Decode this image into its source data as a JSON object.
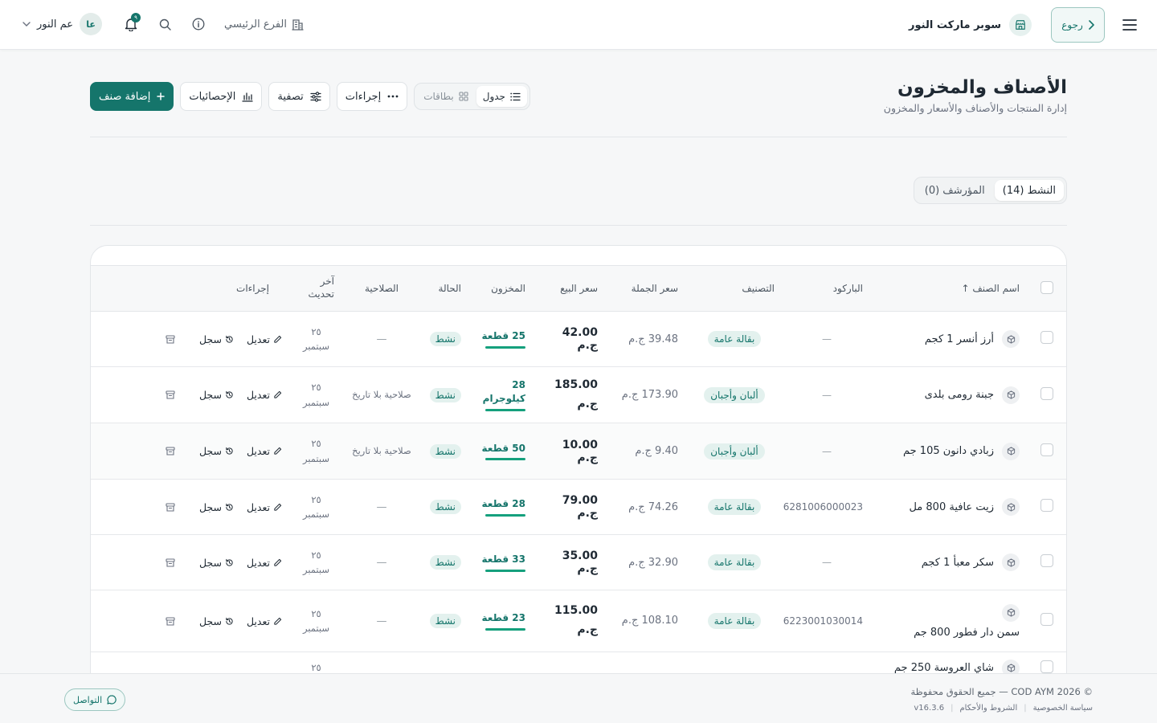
{
  "topbar": {
    "back_label": "رجوع",
    "store_name": "سوبر ماركت النور",
    "branch_label": "الفرع الرئيسي",
    "notifications_count": "٩",
    "user_initials": "عا",
    "user_name": "عم النور"
  },
  "header": {
    "title": "الأصناف والمخزون",
    "subtitle": "إدارة المنتجات والأصناف والأسعار والمخزون"
  },
  "toolbar": {
    "view_table": "جدول",
    "view_cards": "بطاقات",
    "actions_label": "إجراءات",
    "filter_label": "تصفية",
    "stats_label": "الإحصائيات",
    "add_label": "إضافة صنف"
  },
  "tabs": {
    "active_label": "النشط (14)",
    "archived_label": "المؤرشف (0)"
  },
  "table": {
    "columns": {
      "name": "اسم الصنف ↑",
      "barcode": "الباركود",
      "category": "التصنيف",
      "wholesale": "سعر الجملة",
      "sale": "سعر البيع",
      "stock": "المخزون",
      "status": "الحالة",
      "expiry": "الصلاحية",
      "updated": "آخر تحديث",
      "actions": "إجراءات"
    },
    "edit_label": "تعديل",
    "log_label": "سجل",
    "rows": [
      {
        "name": "أرز أنسر 1 كجم",
        "barcode": "—",
        "category": "بقالة عامة",
        "wholesale": "39.48 ج.م",
        "sale": "42.00 ج.م",
        "stock": "25 قطعة",
        "status": "نشط",
        "expiry": "—",
        "updated": "٢٥ سبتمبر"
      },
      {
        "name": "جبنة رومى بلدى",
        "barcode": "—",
        "category": "ألبان وأجبان",
        "wholesale": "173.90 ج.م",
        "sale": "185.00 ج.م",
        "stock": "28 كيلوجرام",
        "status": "نشط",
        "expiry": "صلاحية بلا تاريخ",
        "updated": "٢٥ سبتمبر"
      },
      {
        "name": "زبادي دانون 105 جم",
        "barcode": "—",
        "category": "ألبان وأجبان",
        "wholesale": "9.40 ج.م",
        "sale": "10.00 ج.م",
        "stock": "50 قطعة",
        "status": "نشط",
        "expiry": "صلاحية بلا تاريخ",
        "updated": "٢٥ سبتمبر"
      },
      {
        "name": "زيت عافية 800 مل",
        "barcode": "6281006000023",
        "category": "بقالة عامة",
        "wholesale": "74.26 ج.م",
        "sale": "79.00 ج.م",
        "stock": "28 قطعة",
        "status": "نشط",
        "expiry": "—",
        "updated": "٢٥ سبتمبر"
      },
      {
        "name": "سكر معبأ 1 كجم",
        "barcode": "—",
        "category": "بقالة عامة",
        "wholesale": "32.90 ج.م",
        "sale": "35.00 ج.م",
        "stock": "33 قطعة",
        "status": "نشط",
        "expiry": "—",
        "updated": "٢٥ سبتمبر"
      },
      {
        "name": "سمن دار فطور 800 جم",
        "barcode": "6223001030014",
        "category": "بقالة عامة",
        "wholesale": "108.10 ج.م",
        "sale": "115.00 ج.م",
        "stock": "23 قطعة",
        "status": "نشط",
        "expiry": "—",
        "updated": "٢٥ سبتمبر"
      },
      {
        "name": "شاي العروسة 250 جم",
        "barcode": "",
        "category": "",
        "wholesale": "",
        "sale": "",
        "stock": "",
        "status": "",
        "expiry": "",
        "updated": "٢٥"
      }
    ]
  },
  "footer": {
    "copyright": "© 2026 COD AYM — جميع الحقوق محفوظة",
    "privacy": "سياسة الخصوصية",
    "terms": "الشروط والأحكام",
    "version": "v16.3.6",
    "contact_label": "التواصل"
  },
  "colors": {
    "accent": "#15756b",
    "background": "#f6f7f8"
  }
}
